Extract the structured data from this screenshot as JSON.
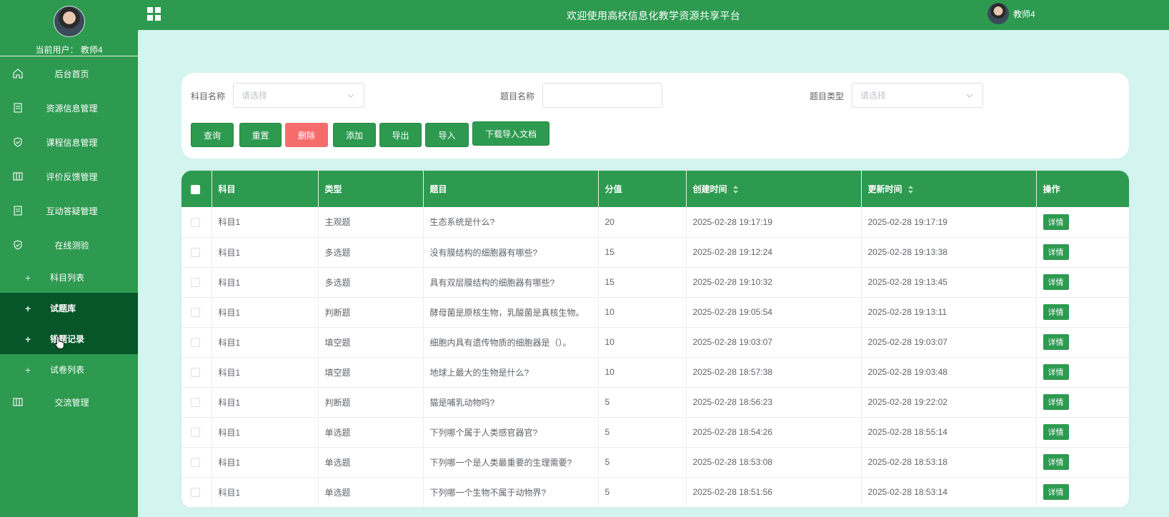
{
  "app": {
    "title": "欢迎使用高校信息化教学资源共享平台",
    "top_username": "教师4",
    "current_user_label": "当前用户： 教师4",
    "accent": "#2d9a50",
    "accent_dark": "#06562a",
    "danger": "#f56c6c"
  },
  "sidebar": {
    "items": [
      {
        "label": "后台首页",
        "icon": "home-icon"
      },
      {
        "label": "资源信息管理",
        "icon": "document-icon"
      },
      {
        "label": "课程信息管理",
        "icon": "shield-icon"
      },
      {
        "label": "评价反馈管理",
        "icon": "columns-icon"
      },
      {
        "label": "互动答疑管理",
        "icon": "document-icon"
      },
      {
        "label": "在线测验",
        "icon": "shield-icon"
      }
    ],
    "sub_items": [
      {
        "label": "科目列表"
      },
      {
        "label": "试题库"
      },
      {
        "label": "错题记录"
      },
      {
        "label": "试卷列表"
      }
    ],
    "last_item": {
      "label": "交流管理",
      "icon": "columns-icon"
    }
  },
  "search": {
    "subject_label": "科目名称",
    "subject_placeholder": "请选择",
    "question_label": "题目名称",
    "question_value": "",
    "type_label": "题目类型",
    "type_placeholder": "请选择"
  },
  "buttons": {
    "query": "查询",
    "reset": "重置",
    "delete": "删除",
    "add": "添加",
    "export": "导出",
    "import": "导入",
    "download": "下载导入文档"
  },
  "table": {
    "headers": {
      "subject": "科目",
      "type": "类型",
      "question": "题目",
      "score": "分值",
      "created": "创建时间",
      "updated": "更新时间",
      "action": "操作"
    },
    "detail_label": "详情",
    "rows": [
      {
        "subject": "科目1",
        "type": "主观题",
        "question": "生态系统是什么?",
        "score": "20",
        "created": "2025-02-28 19:17:19",
        "updated": "2025-02-28 19:17:19"
      },
      {
        "subject": "科目1",
        "type": "多选题",
        "question": "没有膜结构的细胞器有哪些?",
        "score": "15",
        "created": "2025-02-28 19:12:24",
        "updated": "2025-02-28 19:13:38"
      },
      {
        "subject": "科目1",
        "type": "多选题",
        "question": "具有双层膜结构的细胞器有哪些?",
        "score": "15",
        "created": "2025-02-28 19:10:32",
        "updated": "2025-02-28 19:13:45"
      },
      {
        "subject": "科目1",
        "type": "判断题",
        "question": "酵母菌是原核生物，乳酸菌是真核生物。",
        "score": "10",
        "created": "2025-02-28 19:05:54",
        "updated": "2025-02-28 19:13:11"
      },
      {
        "subject": "科目1",
        "type": "填空题",
        "question": "细胞内具有遗传物质的细胞器是（）。",
        "score": "10",
        "created": "2025-02-28 19:03:07",
        "updated": "2025-02-28 19:03:07"
      },
      {
        "subject": "科目1",
        "type": "填空题",
        "question": "地球上最大的生物是什么?",
        "score": "10",
        "created": "2025-02-28 18:57:38",
        "updated": "2025-02-28 19:03:48"
      },
      {
        "subject": "科目1",
        "type": "判断题",
        "question": "猫是哺乳动物吗?",
        "score": "5",
        "created": "2025-02-28 18:56:23",
        "updated": "2025-02-28 19:22:02"
      },
      {
        "subject": "科目1",
        "type": "单选题",
        "question": "下列哪个属于人类感官器官?",
        "score": "5",
        "created": "2025-02-28 18:54:26",
        "updated": "2025-02-28 18:55:14"
      },
      {
        "subject": "科目1",
        "type": "单选题",
        "question": "下列哪一个是人类最重要的生理需要?",
        "score": "5",
        "created": "2025-02-28 18:53:08",
        "updated": "2025-02-28 18:53:18"
      },
      {
        "subject": "科目1",
        "type": "单选题",
        "question": "下列哪一个生物不属于动物界?",
        "score": "5",
        "created": "2025-02-28 18:51:56",
        "updated": "2025-02-28 18:53:14"
      }
    ]
  }
}
